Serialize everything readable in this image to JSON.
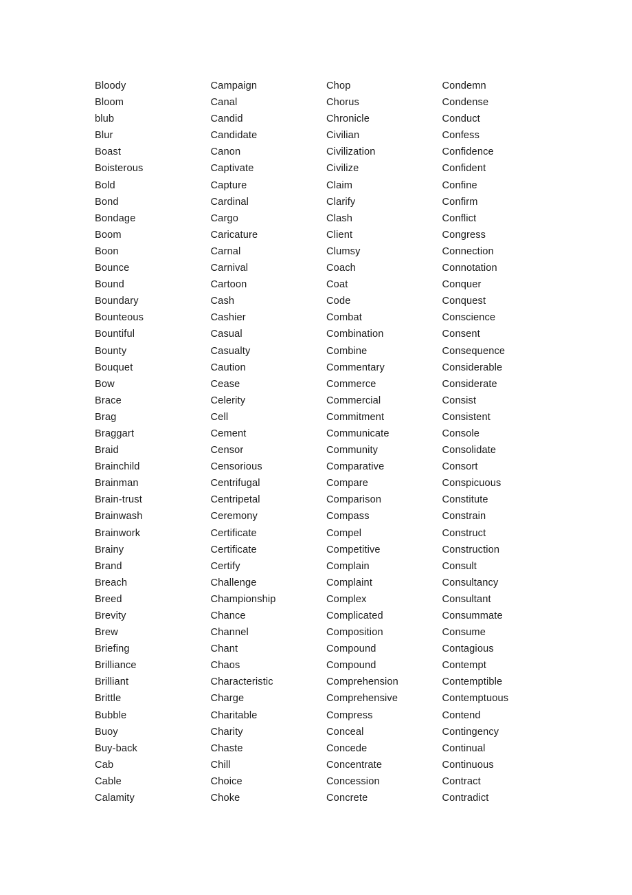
{
  "document": {
    "type": "word-list",
    "background_color": "#ffffff",
    "text_color": "#1a1a1a",
    "columns_count": 4,
    "rows_count": 44
  },
  "columns": [
    {
      "name": "column-1",
      "words": [
        "Bloody",
        "Bloom",
        "blub",
        "Blur",
        "Boast",
        "Boisterous",
        "Bold",
        "Bond",
        "Bondage",
        "Boom",
        "Boon",
        "Bounce",
        "Bound",
        "Boundary",
        "Bounteous",
        "Bountiful",
        "Bounty",
        "Bouquet",
        "Bow",
        "Brace",
        "Brag",
        "Braggart",
        "Braid",
        "Brainchild",
        "Brainman",
        "Brain-trust",
        "Brainwash",
        "Brainwork",
        "Brainy",
        "Brand",
        "Breach",
        "Breed",
        "Brevity",
        "Brew",
        "Briefing",
        "Brilliance",
        "Brilliant",
        "Brittle",
        "Bubble",
        "Buoy",
        "Buy-back",
        "Cab",
        "Cable",
        "Calamity"
      ]
    },
    {
      "name": "column-2",
      "words": [
        "Campaign",
        "Canal",
        "Candid",
        "Candidate",
        "Canon",
        "Captivate",
        "Capture",
        "Cardinal",
        "Cargo",
        "Caricature",
        "Carnal",
        "Carnival",
        "Cartoon",
        "Cash",
        "Cashier",
        "Casual",
        "Casualty",
        "Caution",
        "Cease",
        "Celerity",
        "Cell",
        "Cement",
        "Censor",
        "Censorious",
        "Centrifugal",
        "Centripetal",
        "Ceremony",
        "Certificate",
        "Certificate",
        "Certify",
        "Challenge",
        "Championship",
        "Chance",
        "Channel",
        "Chant",
        "Chaos",
        "Characteristic",
        "Charge",
        "Charitable",
        "Charity",
        "Chaste",
        "Chill",
        "Choice",
        "Choke"
      ]
    },
    {
      "name": "column-3",
      "words": [
        "Chop",
        "Chorus",
        "Chronicle",
        "Civilian",
        "Civilization",
        "Civilize",
        "Claim",
        "Clarify",
        "Clash",
        "Client",
        "Clumsy",
        "Coach",
        "Coat",
        "Code",
        "Combat",
        "Combination",
        "Combine",
        "Commentary",
        "Commerce",
        "Commercial",
        "Commitment",
        "Communicate",
        "Community",
        "Comparative",
        "Compare",
        "Comparison",
        "Compass",
        "Compel",
        "Competitive",
        "Complain",
        "Complaint",
        "Complex",
        "Complicated",
        "Composition",
        "Compound",
        "Compound",
        "Comprehension",
        "Comprehensive",
        "Compress",
        "Conceal",
        "Concede",
        "Concentrate",
        "Concession",
        "Concrete"
      ]
    },
    {
      "name": "column-4",
      "words": [
        "Condemn",
        "Condense",
        "Conduct",
        "Confess",
        "Confidence",
        "Confident",
        "Confine",
        "Confirm",
        "Conflict",
        "Congress",
        "Connection",
        "Connotation",
        "Conquer",
        "Conquest",
        "Conscience",
        "Consent",
        "Consequence",
        "Considerable",
        "Considerate",
        "Consist",
        "Consistent",
        "Console",
        "Consolidate",
        "Consort",
        "Conspicuous",
        "Constitute",
        "Constrain",
        "Construct",
        "Construction",
        "Consult",
        "Consultancy",
        "Consultant",
        "Consummate",
        "Consume",
        "Contagious",
        "Contempt",
        "Contemptible",
        "Contemptuous",
        "Contend",
        "Contingency",
        "Continual",
        "Continuous",
        "Contract",
        "Contradict"
      ]
    }
  ]
}
